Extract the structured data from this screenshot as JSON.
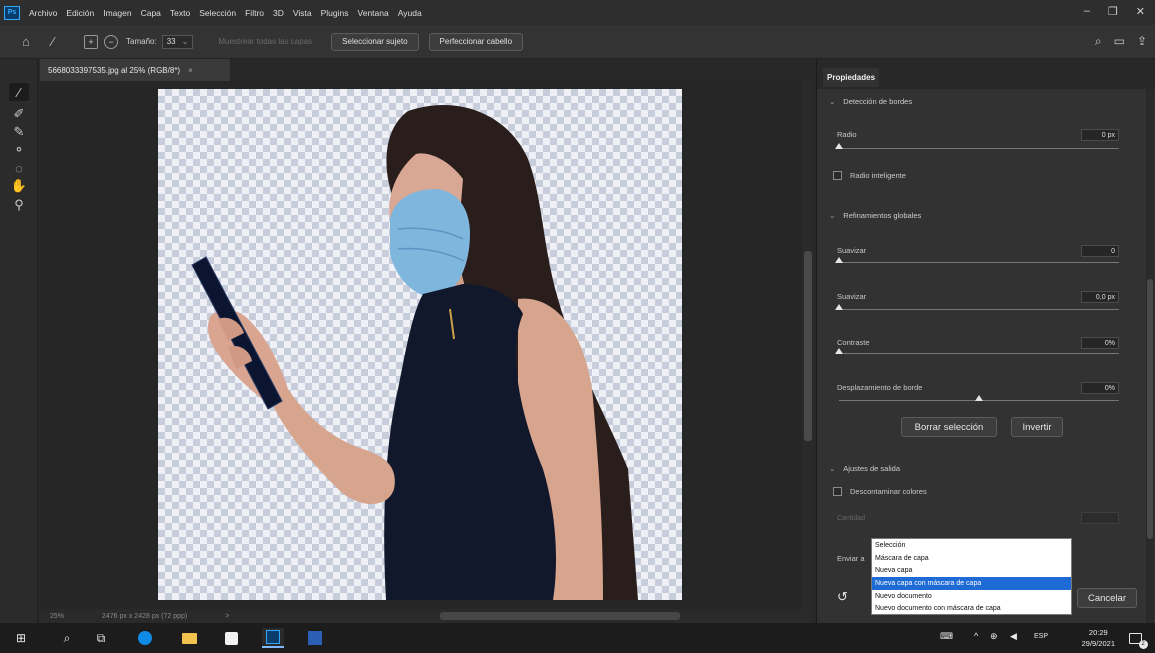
{
  "app": {
    "logo": "Ps"
  },
  "menu": [
    "Archivo",
    "Edición",
    "Imagen",
    "Capa",
    "Texto",
    "Selección",
    "Filtro",
    "3D",
    "Vista",
    "Plugins",
    "Ventana",
    "Ayuda"
  ],
  "window_controls": {
    "minimize": "–",
    "restore": "❐",
    "close": "✕"
  },
  "options_bar": {
    "size_label": "Tamaño:",
    "size_value": "33",
    "sample_all_layers": "Muestrear todas las capas",
    "select_subject": "Seleccionar sujeto",
    "refine_hair": "Perfeccionar cabello"
  },
  "document": {
    "tab_title": "5668033397535.jpg al 25% (RGB/8*)",
    "tab_close": "×",
    "zoom": "25%",
    "info": "2476 px x 2428 px (72 ppp)",
    "status_arrow": ">"
  },
  "properties": {
    "tab": "Propiedades",
    "edge_detection": {
      "title": "Detección de bordes",
      "radius_label": "Radio",
      "radius_value": "0 px",
      "radius_fraction": 0.0,
      "smart_radius": "Radio inteligente",
      "smart_radius_checked": false
    },
    "global_refinements": {
      "title": "Refinamientos globales",
      "smooth_label": "Suavizar",
      "smooth_value": "0",
      "smooth_fraction": 0.0,
      "feather_label": "Suavizar",
      "feather_value": "0,0 px",
      "feather_fraction": 0.0,
      "contrast_label": "Contraste",
      "contrast_value": "0%",
      "contrast_fraction": 0.0,
      "shift_label": "Desplazamiento de borde",
      "shift_value": "0%",
      "shift_fraction": 0.5
    },
    "clear_selection": "Borrar selección",
    "invert": "Invertir",
    "output_settings": {
      "title": "Ajustes de salida",
      "decontaminate": "Descontaminar colores",
      "decontaminate_checked": false,
      "amount": "Cantidad"
    },
    "export_label": "Enviar a",
    "cancel": "Cancelar",
    "reset_icon": "reset-icon"
  },
  "export_options": {
    "items": [
      "Selección",
      "Máscara de capa",
      "Nueva capa",
      "Nueva capa con máscara de capa",
      "Nuevo documento",
      "Nuevo documento con máscara de capa"
    ],
    "selected": "Nueva capa con máscara de capa"
  },
  "taskbar": {
    "language": "ESP",
    "time": "20:29",
    "date": "29/9/2021",
    "notification_count": "2",
    "colors": {
      "edge": "#0f8be6",
      "photoshop": "#31a8ff",
      "word": "#2b5fb5"
    }
  }
}
